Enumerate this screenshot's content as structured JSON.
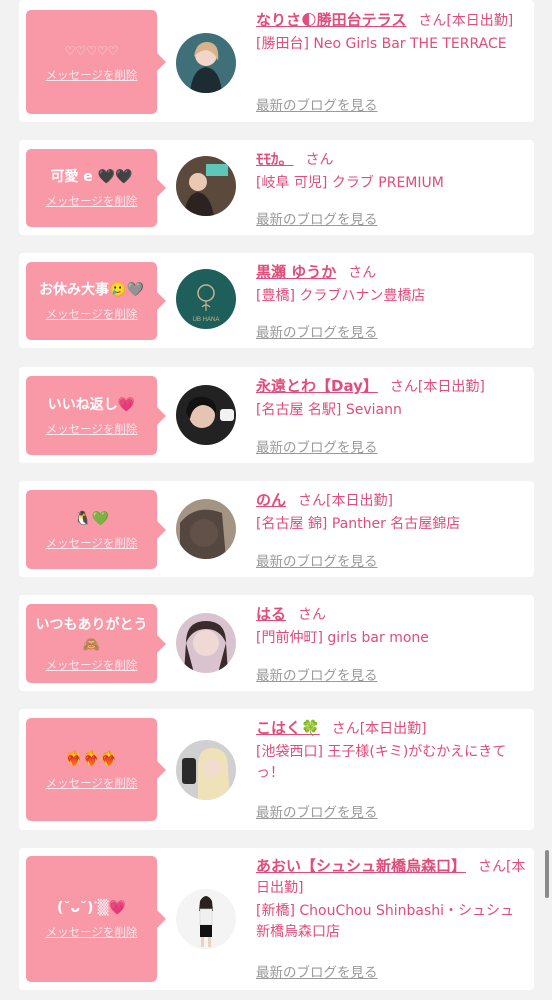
{
  "delete_label": "メッセージを削除",
  "blog_label": "最新のブログを見る",
  "san_label": "さん",
  "items": [
    {
      "message": "♡♡♡♡♡",
      "name": "なりさ🌓勝田台テラス",
      "status": "[本日出勤]",
      "shop": "[勝田台] Neo Girls Bar THE TERRACE"
    },
    {
      "message": "可愛 e 🖤🖤",
      "name": "ﾓﾓｶ。",
      "status": "",
      "shop": "[岐阜 可児] クラブ PREMIUM"
    },
    {
      "message": "お休み大事🥲🩶",
      "name": "黒瀬 ゆうか",
      "status": "",
      "shop": "[豊橋] クラブハナン豊橋店"
    },
    {
      "message": "いいね返し💗",
      "name": "永遠とわ【Day】",
      "status": "[本日出勤]",
      "shop": "[名古屋 名駅] Seviann"
    },
    {
      "message": "🐧💚",
      "name": "のん",
      "status": "[本日出勤]",
      "shop": "[名古屋 錦] Panther 名古屋錦店"
    },
    {
      "message": "いつもありがとう🙈",
      "name": "はる",
      "status": "",
      "shop": "[門前仲町] girls bar mone"
    },
    {
      "message": "❤️‍🔥❤️‍🔥❤️‍🔥",
      "name": "こはく🍀",
      "status": "[本日出勤]",
      "shop": "[池袋西口] 王子様(キミ)がむかえにきてっ！"
    },
    {
      "message": "(˘ᴗ˘)ᐝ▒💗",
      "name": "あおい【シュシュ新橋烏森口】",
      "status": "[本日出勤]",
      "shop": "[新橋] ChouChou Shinbashi・シュシュ新橋烏森口店"
    }
  ]
}
